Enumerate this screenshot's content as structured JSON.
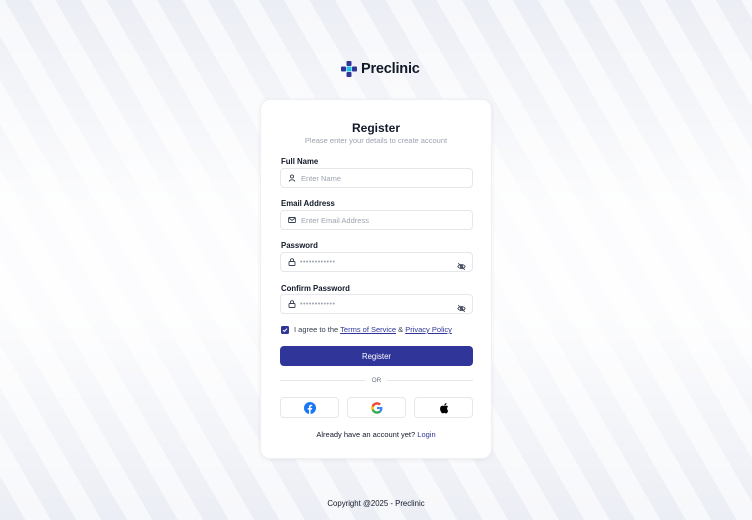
{
  "brand": {
    "name": "Preclinic",
    "accent": "#2f3599"
  },
  "register": {
    "title": "Register",
    "subtitle": "Please enter your details to create account",
    "full_name": {
      "label": "Full Name",
      "placeholder": "Enter Name",
      "icon": "user-icon"
    },
    "email": {
      "label": "Email Address",
      "placeholder": "Enter Email Address",
      "icon": "mail-icon"
    },
    "password": {
      "label": "Password",
      "value": "••••••••••••",
      "icon": "lock-icon",
      "toggle_icon": "eye-off-icon"
    },
    "confirm_password": {
      "label": "Confirm Password",
      "value": "••••••••••••",
      "icon": "lock-icon",
      "toggle_icon": "eye-off-icon"
    },
    "agree": {
      "checked": true,
      "prefix": "I agree to the",
      "terms": "Terms of Service",
      "amp": "&",
      "privacy": "Privacy Policy"
    },
    "submit_label": "Register",
    "divider": "OR",
    "social": [
      "facebook-icon",
      "google-icon",
      "apple-icon"
    ],
    "already": {
      "text": "Already have an account yet?",
      "link": "Login"
    }
  },
  "footer": {
    "copyright": "Copyright @2025 - Preclinic"
  }
}
